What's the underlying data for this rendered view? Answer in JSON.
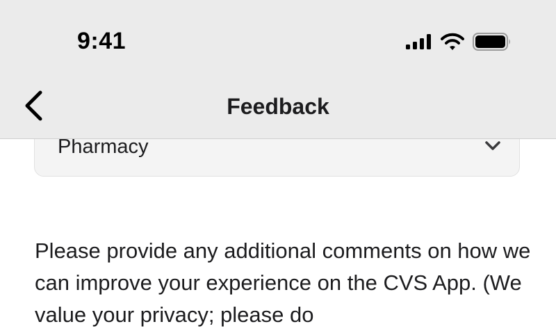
{
  "status_bar": {
    "time": "9:41",
    "icons": [
      "cellular-signal-icon",
      "wifi-icon",
      "battery-icon"
    ]
  },
  "nav": {
    "back_icon": "chevron-left-icon",
    "title": "Feedback"
  },
  "form": {
    "category_select": {
      "value": "Pharmacy",
      "icon": "chevron-down-icon"
    },
    "comments_prompt": "Please provide any additional comments on how we can improve your experience on the CVS App. (We value your privacy; please do"
  },
  "colors": {
    "header_bg": "#ebebeb",
    "page_bg": "#ffffff",
    "select_bg": "#f4f4f4",
    "text": "#1c1c1e"
  }
}
